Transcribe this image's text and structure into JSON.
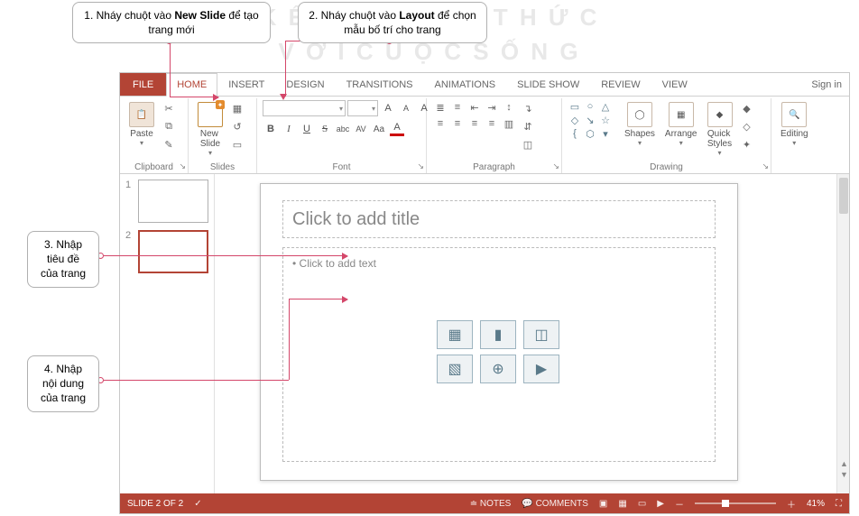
{
  "watermark_line1": "K Ế T  N Ố I  T R I  T H Ứ C",
  "watermark_line2": "V Ớ I  C U Ộ C  S Ố N G",
  "callouts": {
    "c1_pre": "1. Nháy chuột vào ",
    "c1_bold": "New Slide",
    "c1_post": " để tạo trang mới",
    "c2_pre": "2. Nháy chuột vào ",
    "c2_bold": "Layout",
    "c2_post": " để chọn mẫu bố trí cho trang",
    "c3": "3. Nhập tiêu đề của trang",
    "c4": "4. Nhập nội dung của trang"
  },
  "tabs": {
    "file": "FILE",
    "home": "HOME",
    "insert": "INSERT",
    "design": "DESIGN",
    "transitions": "TRANSITIONS",
    "animations": "ANIMATIONS",
    "slideshow": "SLIDE SHOW",
    "review": "REVIEW",
    "view": "VIEW"
  },
  "signin": "Sign in",
  "ribbon": {
    "clipboard": {
      "label": "Clipboard",
      "paste": "Paste"
    },
    "slides": {
      "label": "Slides",
      "newslide": "New\nSlide"
    },
    "font": {
      "label": "Font",
      "bold": "B",
      "italic": "I",
      "underline": "U",
      "strike": "S",
      "shadow": "abc",
      "spacing": "AV",
      "caps": "Aa",
      "clear": "A"
    },
    "paragraph": {
      "label": "Paragraph"
    },
    "drawing": {
      "label": "Drawing",
      "shapes": "Shapes",
      "arrange": "Arrange",
      "quick": "Quick\nStyles"
    },
    "editing": {
      "label": "Editing"
    }
  },
  "thumbs": {
    "n1": "1",
    "n2": "2"
  },
  "slide": {
    "title_placeholder": "Click to add title",
    "body_placeholder": "• Click to add text"
  },
  "status": {
    "slide": "SLIDE 2 OF 2",
    "notes": "NOTES",
    "comments": "COMMENTS",
    "zoom": "41%"
  },
  "glyph": {
    "cut": "✂",
    "copy": "⧉",
    "brush": "✎",
    "layout": "▦",
    "reset": "↺",
    "section": "▭",
    "dropdown": "▾",
    "launcher": "↘",
    "bullets": "≣",
    "numbers": "≡",
    "indent_dec": "⇤",
    "indent_inc": "⇥",
    "align_l": "≡",
    "align_c": "≡",
    "align_r": "≡",
    "align_j": "≡",
    "lineheight": "↕",
    "columns": "▥",
    "textdir": "↴",
    "aligntxt": "⇵",
    "smartart": "◫",
    "plus": "＋",
    "minus": "－",
    "fit": "⛶",
    "table": "▦",
    "chart": "▮",
    "smart": "◫",
    "pic": "▧",
    "online": "⊕",
    "video": "▶",
    "shape_fill": "◆",
    "shape_outline": "◇",
    "shape_effects": "✦"
  }
}
